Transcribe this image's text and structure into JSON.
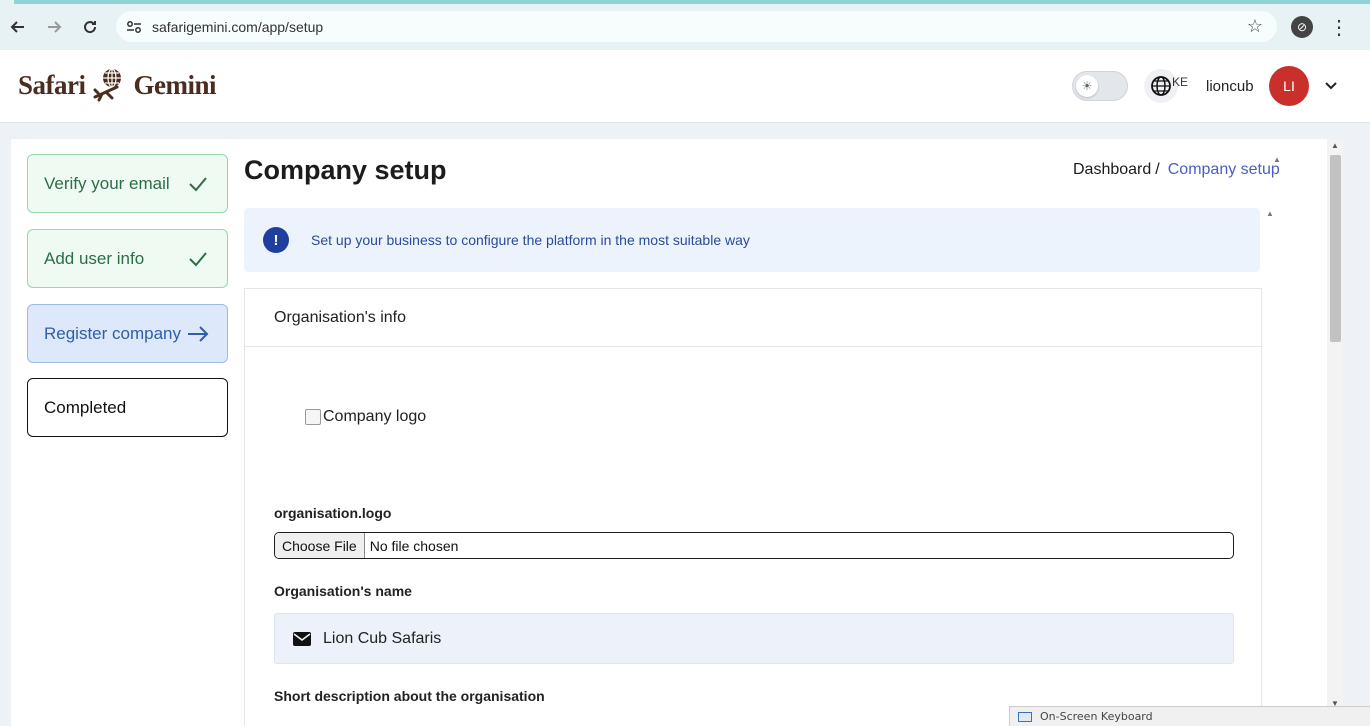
{
  "browser": {
    "url": "safarigemini.com/app/setup"
  },
  "header": {
    "brand_left": "Safari",
    "brand_right": "Gemini",
    "lang_code": "KE",
    "username": "lioncub",
    "avatar_initials": "LI",
    "avatar_color": "#c9302c"
  },
  "steps": [
    {
      "label": "Verify your email",
      "status": "done",
      "icon": "check-icon"
    },
    {
      "label": "Add user info",
      "status": "done",
      "icon": "check-icon"
    },
    {
      "label": "Register company",
      "status": "current",
      "icon": "arrow-right-icon"
    },
    {
      "label": "Completed",
      "status": "pending",
      "icon": ""
    }
  ],
  "page": {
    "title": "Company setup",
    "breadcrumb": {
      "home": "Dashboard",
      "separator": "/",
      "current": "Company setup"
    },
    "banner": {
      "icon": "!",
      "text": "Set up your business to configure the platform in the most suitable way"
    }
  },
  "org_card": {
    "title": "Organisation's info",
    "logo_alt": "Company logo",
    "logo_label": "organisation.logo",
    "file_button": "Choose File",
    "file_status": "No file chosen",
    "name_label": "Organisation's name",
    "name_value": "Lion Cub Safaris",
    "description_label": "Short description about the organisation"
  },
  "taskbar": {
    "osk_label": "On-Screen Keyboard"
  }
}
